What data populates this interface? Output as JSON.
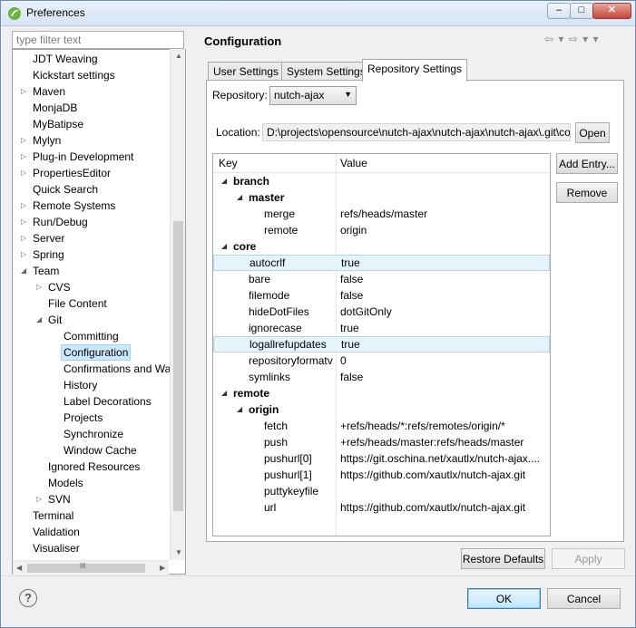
{
  "window": {
    "title": "Preferences",
    "minimize": "–",
    "maximize": "□",
    "close": "✕"
  },
  "sidebar": {
    "filter_placeholder": "type filter text",
    "items": [
      {
        "label": "JDT Weaving",
        "level": 0,
        "arrow": ""
      },
      {
        "label": "Kickstart settings",
        "level": 0,
        "arrow": ""
      },
      {
        "label": "Maven",
        "level": 0,
        "arrow": "▷"
      },
      {
        "label": "MonjaDB",
        "level": 0,
        "arrow": ""
      },
      {
        "label": "MyBatipse",
        "level": 0,
        "arrow": ""
      },
      {
        "label": "Mylyn",
        "level": 0,
        "arrow": "▷"
      },
      {
        "label": "Plug-in Development",
        "level": 0,
        "arrow": "▷"
      },
      {
        "label": "PropertiesEditor",
        "level": 0,
        "arrow": "▷"
      },
      {
        "label": "Quick Search",
        "level": 0,
        "arrow": ""
      },
      {
        "label": "Remote Systems",
        "level": 0,
        "arrow": "▷"
      },
      {
        "label": "Run/Debug",
        "level": 0,
        "arrow": "▷"
      },
      {
        "label": "Server",
        "level": 0,
        "arrow": "▷"
      },
      {
        "label": "Spring",
        "level": 0,
        "arrow": "▷"
      },
      {
        "label": "Team",
        "level": 0,
        "arrow": "◢"
      },
      {
        "label": "CVS",
        "level": 1,
        "arrow": "▷"
      },
      {
        "label": "File Content",
        "level": 1,
        "arrow": ""
      },
      {
        "label": "Git",
        "level": 1,
        "arrow": "◢"
      },
      {
        "label": "Committing",
        "level": 2,
        "arrow": ""
      },
      {
        "label": "Configuration",
        "level": 2,
        "arrow": "",
        "selected": true
      },
      {
        "label": "Confirmations and Wa",
        "level": 2,
        "arrow": ""
      },
      {
        "label": "History",
        "level": 2,
        "arrow": ""
      },
      {
        "label": "Label Decorations",
        "level": 2,
        "arrow": ""
      },
      {
        "label": "Projects",
        "level": 2,
        "arrow": ""
      },
      {
        "label": "Synchronize",
        "level": 2,
        "arrow": ""
      },
      {
        "label": "Window Cache",
        "level": 2,
        "arrow": ""
      },
      {
        "label": "Ignored Resources",
        "level": 1,
        "arrow": ""
      },
      {
        "label": "Models",
        "level": 1,
        "arrow": ""
      },
      {
        "label": "SVN",
        "level": 1,
        "arrow": "▷"
      },
      {
        "label": "Terminal",
        "level": 0,
        "arrow": ""
      },
      {
        "label": "Validation",
        "level": 0,
        "arrow": ""
      },
      {
        "label": "Visualiser",
        "level": 0,
        "arrow": ""
      }
    ],
    "hscroll_grip": "III"
  },
  "page": {
    "title": "Configuration",
    "nav": "⇦ ▾ ⇨ ▾ ▾",
    "tabs": [
      {
        "label": "User Settings"
      },
      {
        "label": "System Settings"
      },
      {
        "label": "Repository Settings",
        "active": true
      }
    ],
    "repository_label": "Repository:",
    "repository_value": "nutch-ajax",
    "location_label": "Location:",
    "location_value": "D:\\projects\\opensource\\nutch-ajax\\nutch-ajax\\nutch-ajax\\.git\\config",
    "open_button": "Open",
    "add_entry_button": "Add Entry...",
    "remove_button": "Remove",
    "table": {
      "headers": {
        "key": "Key",
        "value": "Value"
      },
      "rows": [
        {
          "key": "branch",
          "value": "",
          "level": 0,
          "section": true
        },
        {
          "key": "master",
          "value": "",
          "level": 1,
          "section": true
        },
        {
          "key": "merge",
          "value": "refs/heads/master",
          "level": 2
        },
        {
          "key": "remote",
          "value": "origin",
          "level": 2
        },
        {
          "key": "core",
          "value": "",
          "level": 0,
          "section": true
        },
        {
          "key": "autocrlf",
          "value": "true",
          "level": 1,
          "highlight": true
        },
        {
          "key": "bare",
          "value": "false",
          "level": 1
        },
        {
          "key": "filemode",
          "value": "false",
          "level": 1
        },
        {
          "key": "hideDotFiles",
          "value": "dotGitOnly",
          "level": 1
        },
        {
          "key": "ignorecase",
          "value": "true",
          "level": 1
        },
        {
          "key": "logallrefupdates",
          "value": "true",
          "level": 1,
          "highlight": true
        },
        {
          "key": "repositoryformatv",
          "value": "0",
          "level": 1
        },
        {
          "key": "symlinks",
          "value": "false",
          "level": 1
        },
        {
          "key": "remote",
          "value": "",
          "level": 0,
          "section": true
        },
        {
          "key": "origin",
          "value": "",
          "level": 1,
          "section": true
        },
        {
          "key": "fetch",
          "value": "+refs/heads/*:refs/remotes/origin/*",
          "level": 2
        },
        {
          "key": "push",
          "value": "+refs/heads/master:refs/heads/master",
          "level": 2
        },
        {
          "key": "pushurl[0]",
          "value": "https://git.oschina.net/xautlx/nutch-ajax....",
          "level": 2
        },
        {
          "key": "pushurl[1]",
          "value": "https://github.com/xautlx/nutch-ajax.git",
          "level": 2
        },
        {
          "key": "puttykeyfile",
          "value": "",
          "level": 2
        },
        {
          "key": "url",
          "value": "https://github.com/xautlx/nutch-ajax.git",
          "level": 2
        }
      ]
    },
    "restore_defaults_button": "Restore Defaults",
    "apply_button": "Apply"
  },
  "footer": {
    "help": "?",
    "ok_button": "OK",
    "cancel_button": "Cancel"
  }
}
